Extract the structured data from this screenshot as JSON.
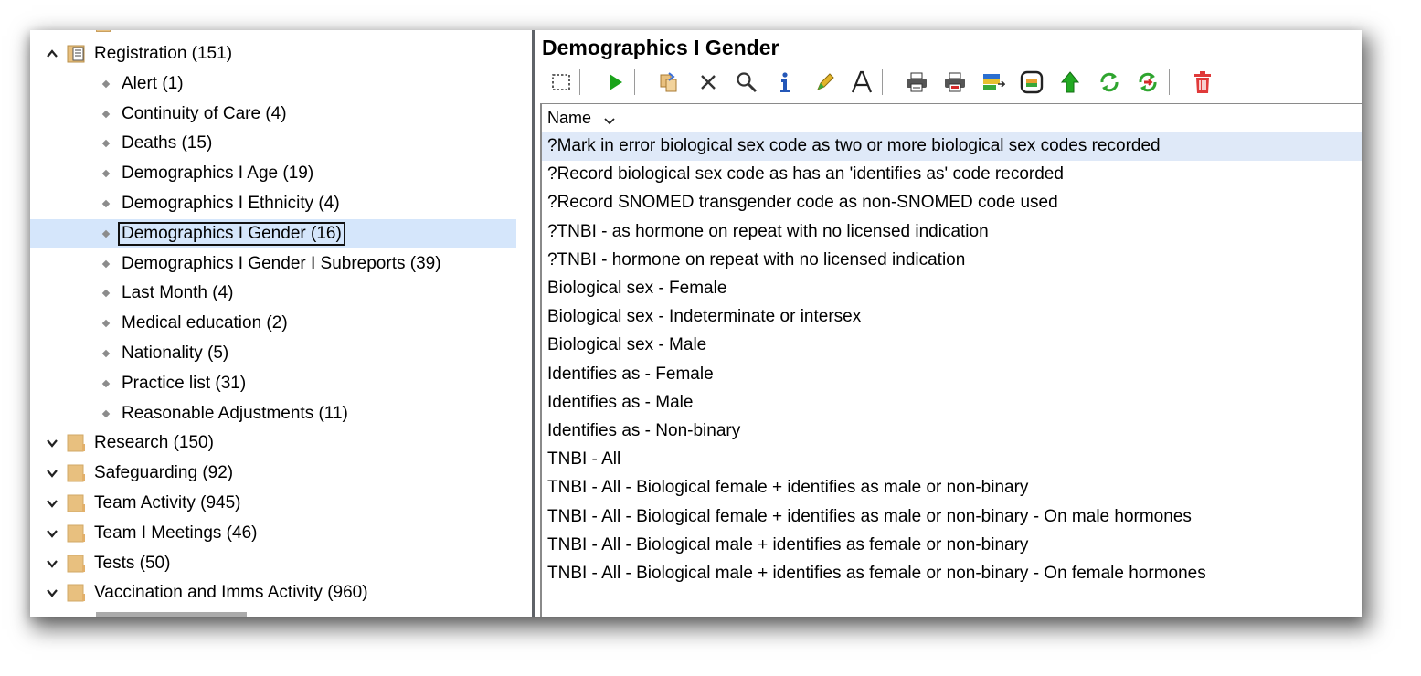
{
  "tree": {
    "items": [
      {
        "label": "Registration (151)",
        "level": 0,
        "expanded": true
      },
      {
        "label": "Alert (1)",
        "level": 1
      },
      {
        "label": "Continuity of Care (4)",
        "level": 1
      },
      {
        "label": "Deaths (15)",
        "level": 1
      },
      {
        "label": "Demographics I Age (19)",
        "level": 1
      },
      {
        "label": "Demographics I Ethnicity (4)",
        "level": 1
      },
      {
        "label": "Demographics I Gender (16)",
        "level": 1,
        "selected": true
      },
      {
        "label": "Demographics I Gender I Subreports (39)",
        "level": 1
      },
      {
        "label": "Last Month (4)",
        "level": 1
      },
      {
        "label": "Medical education (2)",
        "level": 1
      },
      {
        "label": "Nationality (5)",
        "level": 1
      },
      {
        "label": "Practice list (31)",
        "level": 1
      },
      {
        "label": "Reasonable Adjustments (11)",
        "level": 1
      },
      {
        "label": "Research (150)",
        "level": 0,
        "expanded": false
      },
      {
        "label": "Safeguarding (92)",
        "level": 0,
        "expanded": false
      },
      {
        "label": "Team Activity (945)",
        "level": 0,
        "expanded": false
      },
      {
        "label": "Team I Meetings (46)",
        "level": 0,
        "expanded": false
      },
      {
        "label": "Tests (50)",
        "level": 0,
        "expanded": false
      },
      {
        "label": "Vaccination and Imms Activity (960)",
        "level": 0,
        "expanded": false
      }
    ]
  },
  "panel": {
    "title": "Demographics I Gender"
  },
  "toolbar": {
    "buttons": [
      {
        "name": "select-all-icon"
      },
      {
        "name": "run-icon"
      },
      {
        "name": "copy-move-icon"
      },
      {
        "name": "delete-x-icon"
      },
      {
        "name": "search-icon"
      },
      {
        "name": "info-icon"
      },
      {
        "name": "edit-pencil-icon"
      },
      {
        "name": "font-icon"
      },
      {
        "name": "print-icon"
      },
      {
        "name": "print-red-icon"
      },
      {
        "name": "export-icon"
      },
      {
        "name": "view-icon"
      },
      {
        "name": "upload-icon"
      },
      {
        "name": "refresh-icon"
      },
      {
        "name": "refresh-red-icon"
      },
      {
        "name": "trash-icon"
      }
    ]
  },
  "list": {
    "column_header": "Name",
    "rows": [
      {
        "label": "?Mark in error biological sex code as two or more biological sex codes recorded",
        "selected": true
      },
      {
        "label": "?Record biological sex code as has an 'identifies as' code recorded"
      },
      {
        "label": "?Record SNOMED transgender code as non-SNOMED code used"
      },
      {
        "label": "?TNBI - as hormone on repeat with no licensed indication"
      },
      {
        "label": "?TNBI - hormone on repeat with no licensed indication"
      },
      {
        "label": "Biological sex - Female"
      },
      {
        "label": "Biological sex - Indeterminate or intersex"
      },
      {
        "label": "Biological sex - Male"
      },
      {
        "label": "Identifies as - Female"
      },
      {
        "label": "Identifies as - Male"
      },
      {
        "label": "Identifies as - Non-binary"
      },
      {
        "label": "TNBI - All"
      },
      {
        "label": "TNBI - All - Biological female + identifies as male or non-binary"
      },
      {
        "label": "TNBI - All - Biological female + identifies as male or non-binary - On male hormones"
      },
      {
        "label": "TNBI - All - Biological male + identifies as female or non-binary"
      },
      {
        "label": "TNBI - All - Biological male + identifies as female or non-binary - On female hormones"
      }
    ]
  },
  "colors": {
    "tree_selected_bg": "#d5e6fb",
    "list_selected_bg": "#dfe9f8",
    "splitter": "#5f6368",
    "folder": "#e8c07f"
  }
}
